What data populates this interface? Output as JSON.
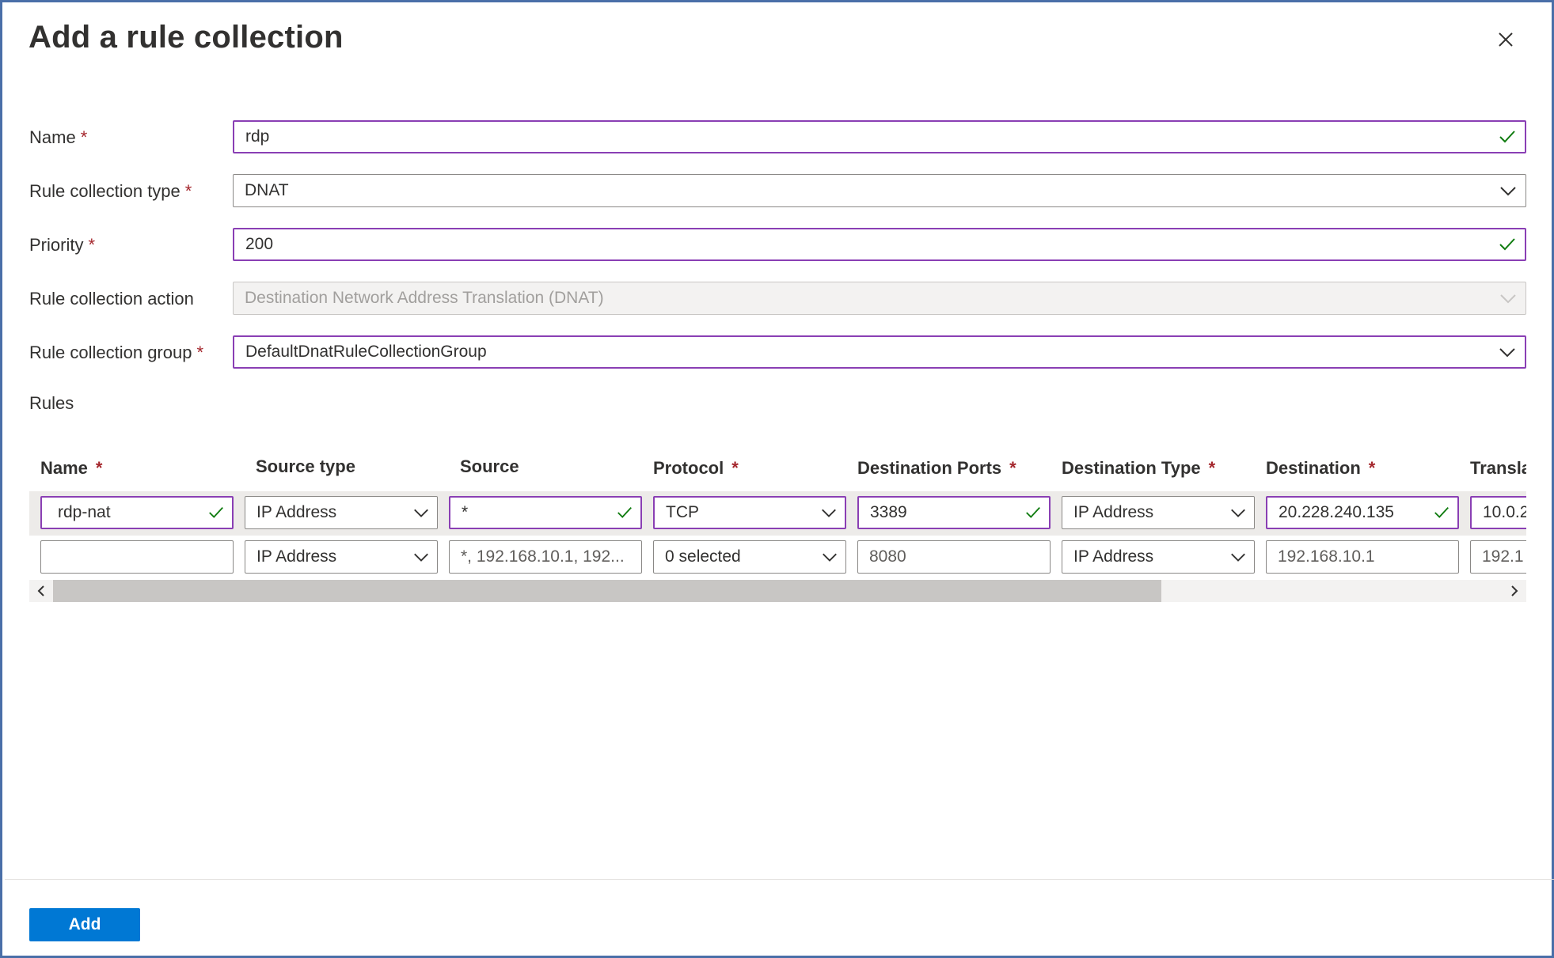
{
  "panel": {
    "title": "Add a rule collection",
    "close_icon": "close-icon"
  },
  "form": {
    "name": {
      "label": "Name",
      "required_mark": "*",
      "value": "rdp",
      "valid": true
    },
    "type": {
      "label": "Rule collection type",
      "required_mark": "*",
      "value": "DNAT"
    },
    "priority": {
      "label": "Priority",
      "required_mark": "*",
      "value": "200",
      "valid": true
    },
    "action": {
      "label": "Rule collection action",
      "value": "Destination Network Address Translation (DNAT)",
      "disabled": true
    },
    "group": {
      "label": "Rule collection group",
      "required_mark": "*",
      "value": "DefaultDnatRuleCollectionGroup"
    }
  },
  "rules": {
    "label": "Rules",
    "columns": [
      {
        "label": "Name",
        "required_mark": "*"
      },
      {
        "label": "Source type",
        "required_mark": ""
      },
      {
        "label": "Source",
        "required_mark": ""
      },
      {
        "label": "Protocol",
        "required_mark": "*"
      },
      {
        "label": "Destination Ports",
        "required_mark": "*"
      },
      {
        "label": "Destination Type",
        "required_mark": "*"
      },
      {
        "label": "Destination",
        "required_mark": "*"
      },
      {
        "label": "Transla",
        "required_mark": ""
      }
    ],
    "rows": [
      {
        "name": "rdp-nat",
        "source_type": "IP Address",
        "source": "*",
        "protocol": "TCP",
        "destination_ports": "3389",
        "destination_type": "IP Address",
        "destination": "20.228.240.135",
        "translated": "10.0.2"
      },
      {
        "name": "",
        "source_type": "IP Address",
        "source_placeholder": "*, 192.168.10.1, 192...",
        "protocol": "0 selected",
        "destination_ports_placeholder": "8080",
        "destination_type": "IP Address",
        "destination_placeholder": "192.168.10.1",
        "translated_placeholder": "192.1"
      }
    ]
  },
  "footer": {
    "add_label": "Add"
  },
  "colors": {
    "accent": "#0078d4",
    "focus_border": "#8a3fb4",
    "valid_check": "#107c10",
    "required": "#a4262c"
  }
}
